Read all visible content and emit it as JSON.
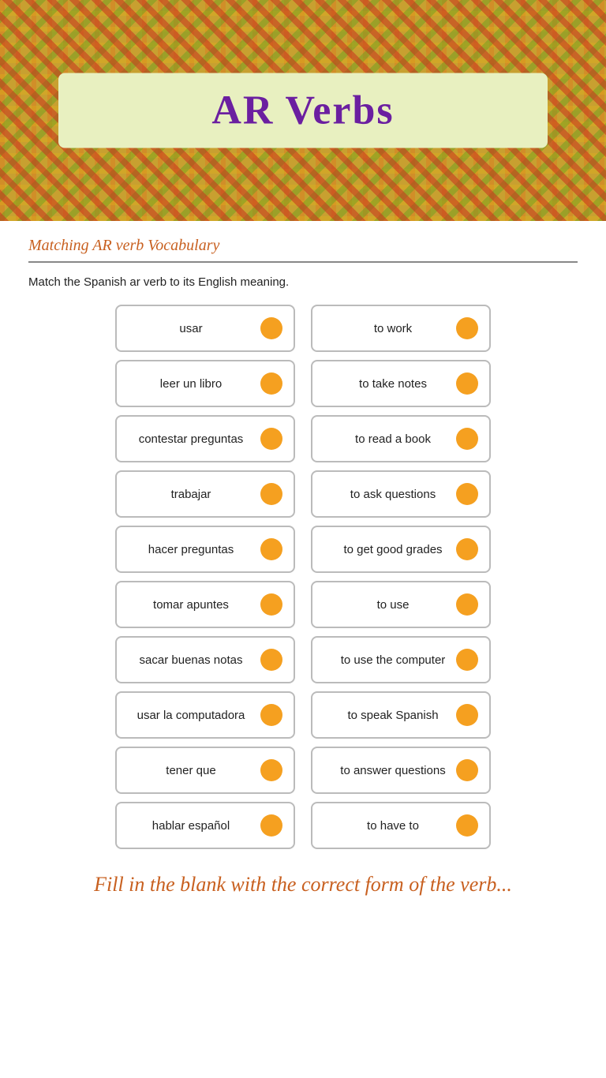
{
  "header": {
    "title": "AR Verbs"
  },
  "section": {
    "title": "Matching AR verb Vocabulary",
    "instruction": "Match the Spanish ar verb to its English meaning."
  },
  "pairs": [
    {
      "spanish": "usar",
      "english": "to work"
    },
    {
      "spanish": "leer un libro",
      "english": "to take notes"
    },
    {
      "spanish": "contestar preguntas",
      "english": "to read a book"
    },
    {
      "spanish": "trabajar",
      "english": "to ask questions"
    },
    {
      "spanish": "hacer preguntas",
      "english": "to get good grades"
    },
    {
      "spanish": "tomar apuntes",
      "english": "to use"
    },
    {
      "spanish": "sacar buenas notas",
      "english": "to use the computer"
    },
    {
      "spanish": "usar la computadora",
      "english": "to speak Spanish"
    },
    {
      "spanish": "tener que",
      "english": "to answer questions"
    },
    {
      "spanish": "hablar español",
      "english": "to have to"
    }
  ],
  "bottom": {
    "title": "Fill in the blank with the correct form of the verb..."
  }
}
